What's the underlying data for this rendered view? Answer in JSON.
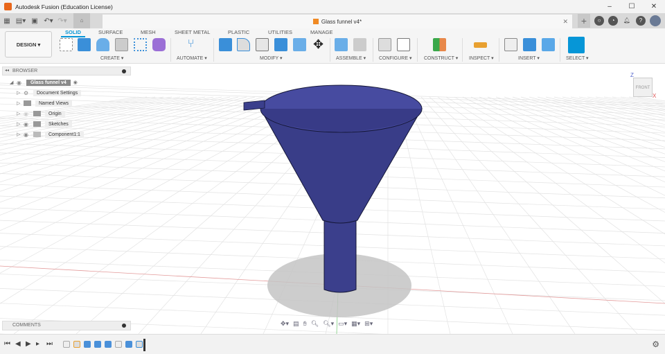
{
  "window": {
    "title": "Autodesk Fusion (Education License)",
    "minimize": "–",
    "maximize": "☐",
    "close": "✕"
  },
  "document": {
    "tab_title": "Glass funnel v4*",
    "close": "✕"
  },
  "workspace": {
    "label": "DESIGN ▾"
  },
  "tabs": [
    {
      "label": "SOLID",
      "active": true
    },
    {
      "label": "SURFACE"
    },
    {
      "label": "MESH"
    },
    {
      "label": "SHEET METAL"
    },
    {
      "label": "PLASTIC"
    },
    {
      "label": "UTILITIES"
    },
    {
      "label": "MANAGE"
    }
  ],
  "groups": [
    "CREATE ▾",
    "AUTOMATE ▾",
    "MODIFY ▾",
    "ASSEMBLE ▾",
    "CONFIGURE ▾",
    "CONSTRUCT ▾",
    "INSPECT ▾",
    "INSERT ▾",
    "SELECT ▾"
  ],
  "browser": {
    "title": "BROWSER",
    "items": [
      "Glass funnel v4",
      "Document Settings",
      "Named Views",
      "Origin",
      "Sketches",
      "Component1:1"
    ]
  },
  "comments": {
    "title": "COMMENTS"
  },
  "viewcube": {
    "face": "FRONT",
    "z": "Z",
    "x": "X"
  },
  "colors": {
    "accent": "#0696d7",
    "funnel": "#3b3f8c",
    "logo": "#e8661a"
  }
}
